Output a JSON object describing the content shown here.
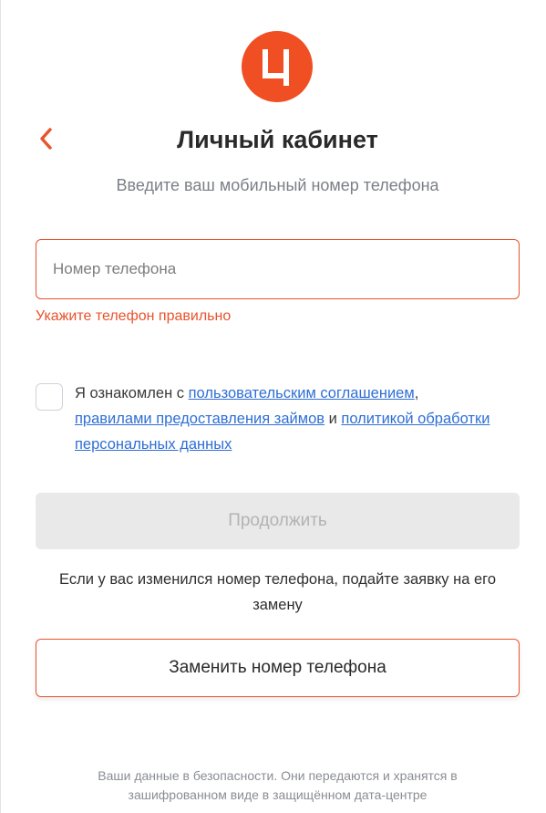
{
  "brand": {
    "logo_letter": "Ц",
    "logo_color": "#f04e23"
  },
  "header": {
    "back_icon": "chevron-left-icon",
    "title": "Личный кабинет",
    "subtitle": "Введите ваш мобильный номер телефона"
  },
  "form": {
    "phone_placeholder": "Номер телефона",
    "phone_value": "",
    "phone_error": "Укажите телефон правильно",
    "agreement": {
      "checked": false,
      "prefix": "Я ознакомлен с ",
      "link1": "пользовательским соглашением",
      "sep1": ",",
      "link2": "правилами предоставления займов",
      "sep2": " и ",
      "link3": "политикой обработки персональных данных"
    },
    "continue_label": "Продолжить"
  },
  "change_phone": {
    "info": "Если у вас изменился номер телефона, подайте заявку на его замену",
    "button_label": "Заменить номер телефона"
  },
  "footer": {
    "security_note": "Ваши данные в безопасности. Они передаются и хранятся в зашифрованном виде в защищённом дата-центре"
  },
  "colors": {
    "accent": "#e8532c",
    "link": "#2f6fd6",
    "muted": "#7b7f86"
  }
}
